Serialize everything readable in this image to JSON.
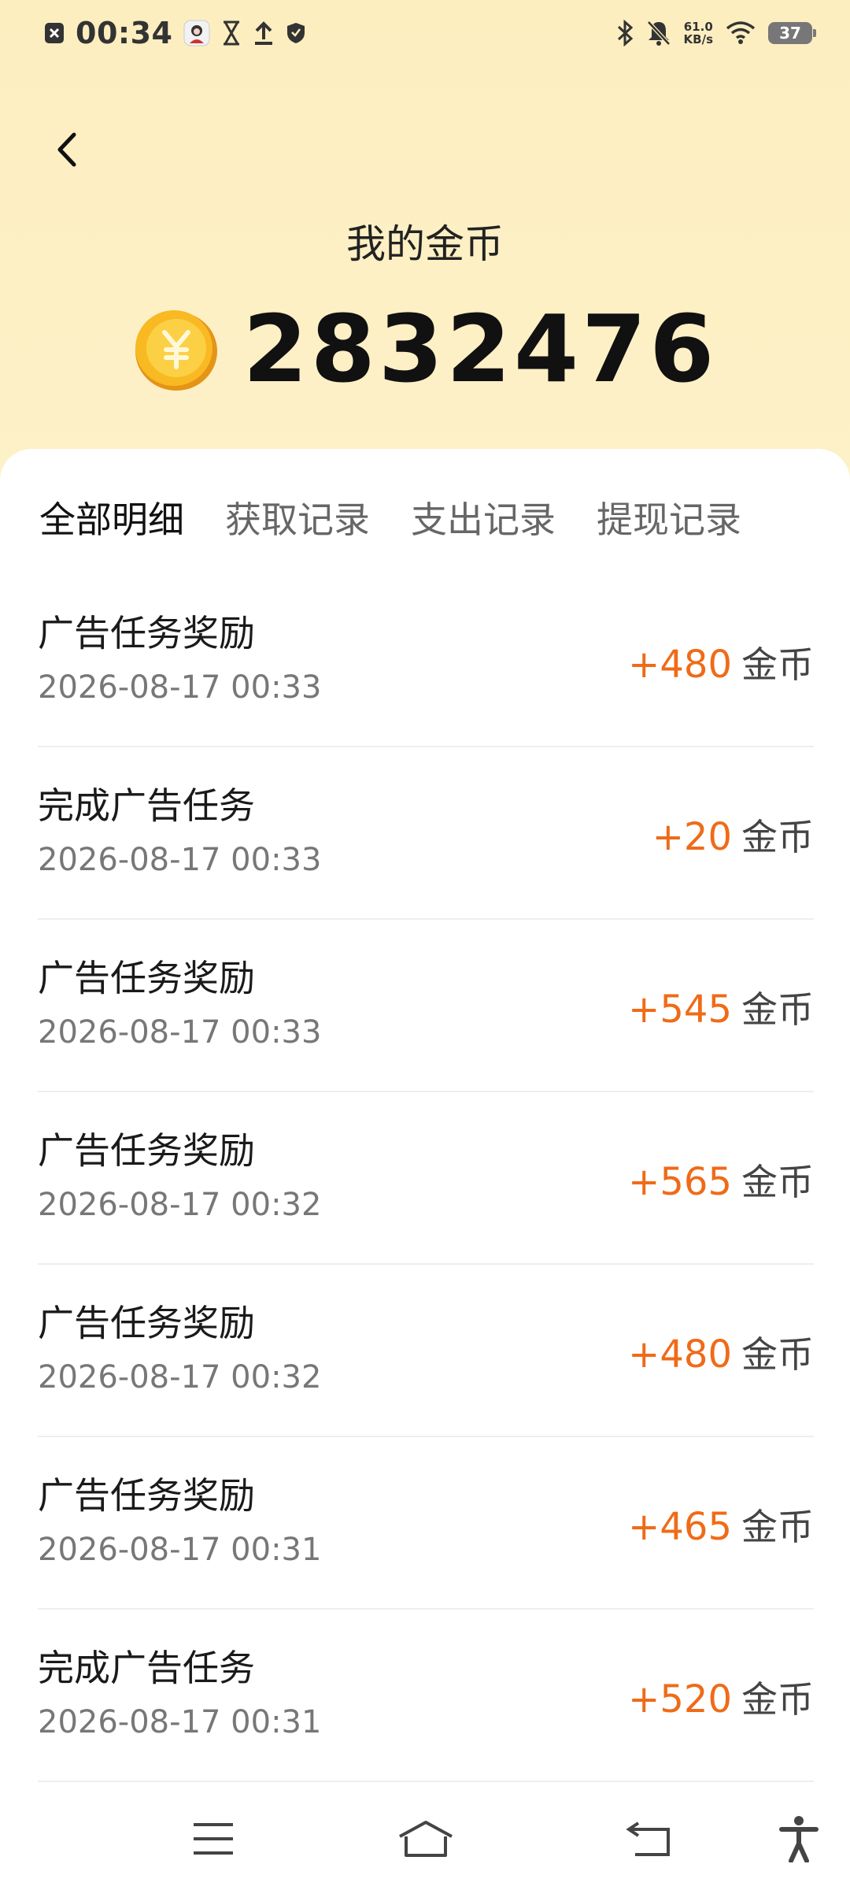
{
  "status_bar": {
    "time": "00:34",
    "net_speed_value": "61.0",
    "net_speed_unit": "KB/s",
    "battery": "37",
    "icons": [
      "close-box-icon",
      "avatar-icon",
      "hourglass-icon",
      "upload-icon",
      "shield-icon",
      "bluetooth-icon",
      "bell-mute-icon",
      "wifi-icon",
      "battery-icon"
    ]
  },
  "header": {
    "title": "我的金币",
    "balance": "2832476",
    "icons": [
      "back-arrow-icon",
      "coin-icon"
    ]
  },
  "tabs": [
    {
      "label": "全部明细",
      "active": true
    },
    {
      "label": "获取记录",
      "active": false
    },
    {
      "label": "支出记录",
      "active": false
    },
    {
      "label": "提现记录",
      "active": false
    }
  ],
  "records": [
    {
      "title": "广告任务奖励",
      "time": "2026-08-17 00:33",
      "amount": "+480",
      "unit": "金币"
    },
    {
      "title": "完成广告任务",
      "time": "2026-08-17 00:33",
      "amount": "+20",
      "unit": "金币"
    },
    {
      "title": "广告任务奖励",
      "time": "2026-08-17 00:33",
      "amount": "+545",
      "unit": "金币"
    },
    {
      "title": "广告任务奖励",
      "time": "2026-08-17 00:32",
      "amount": "+565",
      "unit": "金币"
    },
    {
      "title": "广告任务奖励",
      "time": "2026-08-17 00:32",
      "amount": "+480",
      "unit": "金币"
    },
    {
      "title": "广告任务奖励",
      "time": "2026-08-17 00:31",
      "amount": "+465",
      "unit": "金币"
    },
    {
      "title": "完成广告任务",
      "time": "2026-08-17 00:31",
      "amount": "+520",
      "unit": "金币"
    }
  ],
  "colors": {
    "header_bg": "#fdeec0",
    "amount": "#ef6b18",
    "coin": "#f5b51e"
  },
  "nav_bar": {
    "icons": [
      "menu-icon",
      "home-icon",
      "back-icon",
      "accessibility-icon"
    ]
  }
}
